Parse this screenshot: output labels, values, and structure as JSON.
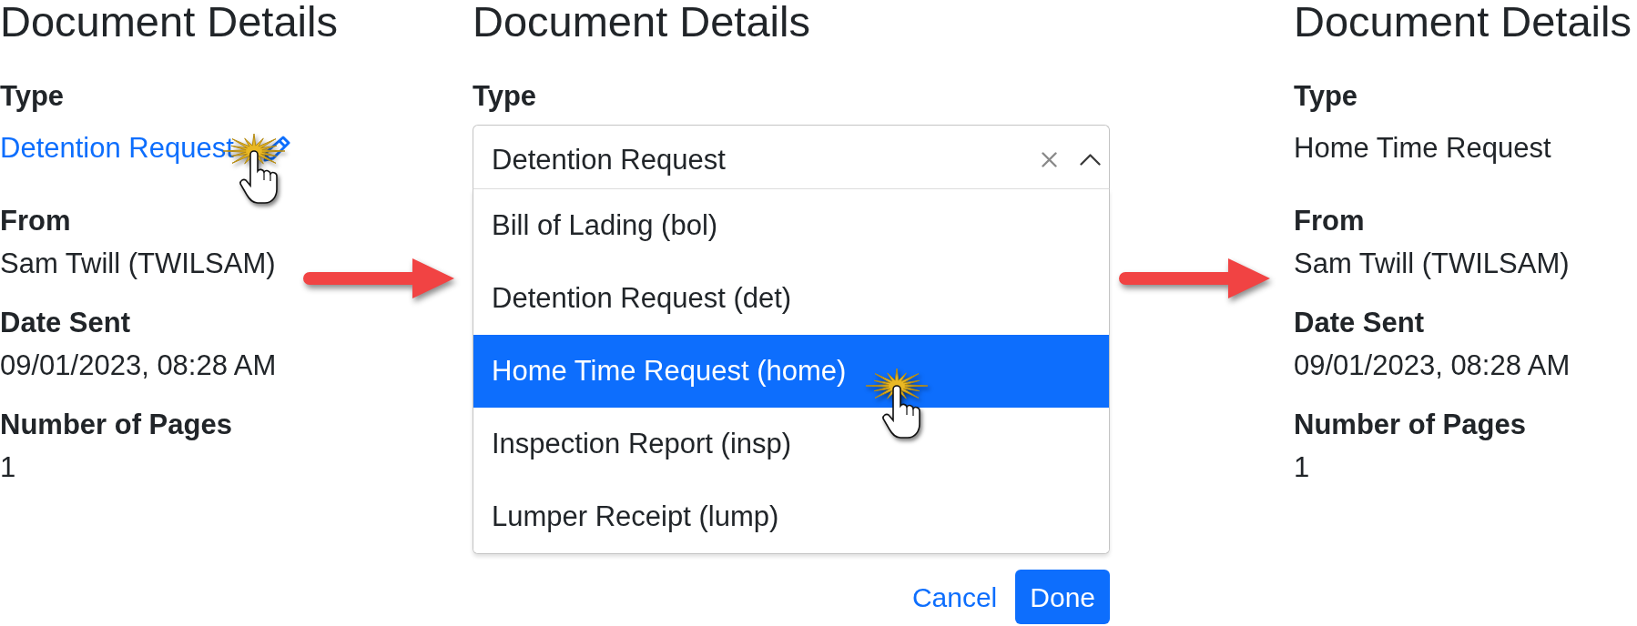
{
  "panels": [
    {
      "kind": "details",
      "title": "Document Details",
      "fields": [
        {
          "label": "Type",
          "value": "Detention Request",
          "kind": "link"
        },
        {
          "label": "From",
          "value": "Sam Twill (TWILSAM)",
          "kind": "text"
        },
        {
          "label": "Date Sent",
          "value": "09/01/2023, 08:28 AM",
          "kind": "text"
        },
        {
          "label": "Number of Pages",
          "value": "1",
          "kind": "text"
        }
      ]
    },
    {
      "kind": "editor",
      "title": "Document Details",
      "field_label": "Type",
      "select": {
        "value": "Detention Request",
        "expanded": true,
        "options": [
          {
            "label": "Bill of Lading (bol)",
            "selected": false
          },
          {
            "label": "Detention Request (det)",
            "selected": false
          },
          {
            "label": "Home Time Request (home)",
            "selected": true
          },
          {
            "label": "Inspection Report (insp)",
            "selected": false
          },
          {
            "label": "Lumper Receipt (lump)",
            "selected": false
          }
        ]
      },
      "buttons": [
        {
          "label": "Cancel",
          "kind": "link"
        },
        {
          "label": "Done",
          "kind": "primary"
        }
      ]
    },
    {
      "kind": "details",
      "title": "Document Details",
      "fields": [
        {
          "label": "Type",
          "value": "Home Time Request",
          "kind": "text"
        },
        {
          "label": "From",
          "value": "Sam Twill (TWILSAM)",
          "kind": "text"
        },
        {
          "label": "Date Sent",
          "value": "09/01/2023, 08:28 AM",
          "kind": "text"
        },
        {
          "label": "Number of Pages",
          "value": "1",
          "kind": "text"
        }
      ]
    }
  ]
}
